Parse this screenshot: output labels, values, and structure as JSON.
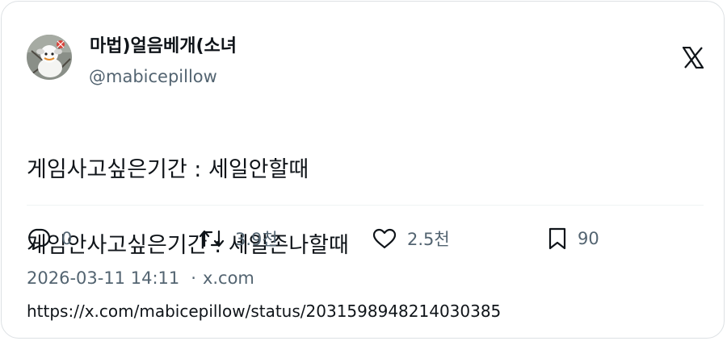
{
  "tweet": {
    "display_name": "마법)얼음베개(소녀",
    "handle": "@mabicepillow",
    "lines": [
      "게임사고싶은기간 : 세일안할때",
      "게임안사고싶은기간 : 세일존나할때"
    ],
    "actions": {
      "reply_count": "0",
      "retweet_count": "3.9천",
      "like_count": "2.5천",
      "bookmark_count": "90"
    },
    "timestamp": "2026-03-11 14:11",
    "separator": "·",
    "source": "x.com",
    "url": "https://x.com/mabicepillow/status/2031598948214030385"
  },
  "icons": {
    "reply": "reply-icon",
    "retweet": "retweet-icon",
    "like": "heart-icon",
    "bookmark": "bookmark-icon",
    "brand": "x-logo-icon",
    "avatar": "avatar"
  },
  "colors": {
    "text": "#0f1419",
    "secondary": "#536471",
    "border": "#dde1e4"
  }
}
